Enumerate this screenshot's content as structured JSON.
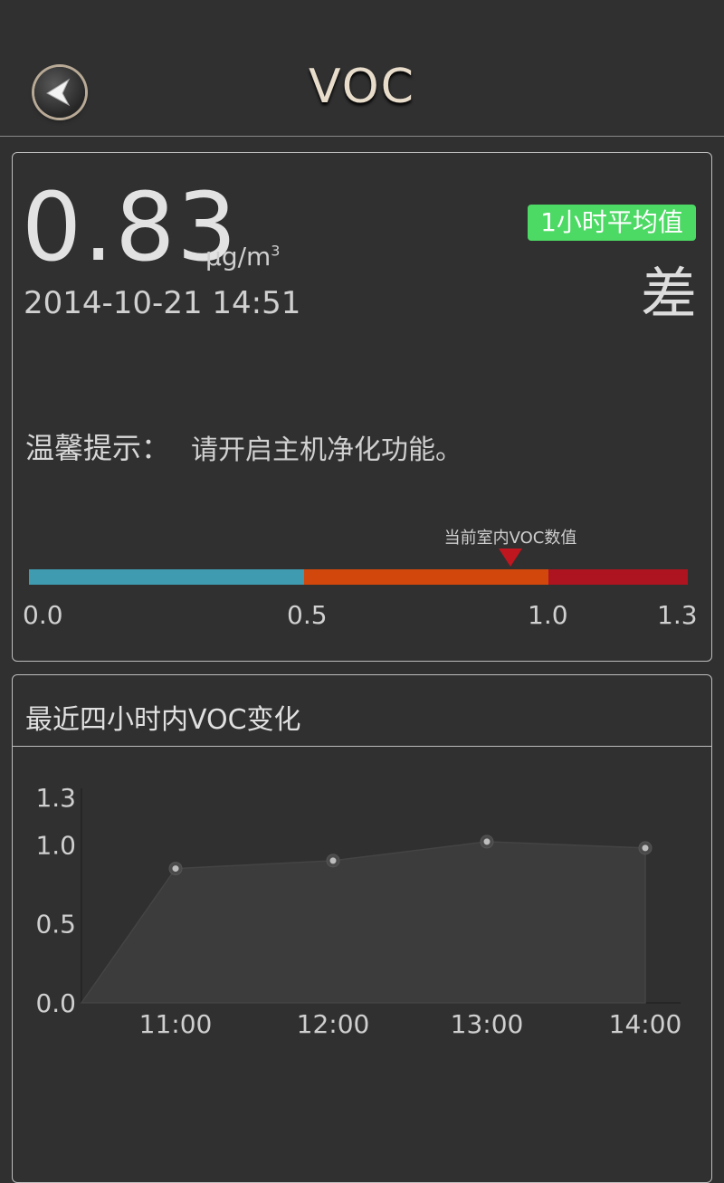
{
  "header": {
    "title": "VOC"
  },
  "reading": {
    "value": "0.83",
    "unit": "μg/m",
    "unit_sup": "3",
    "datetime": "2014-10-21 14:51",
    "badge": "1小时平均值",
    "quality": "差"
  },
  "tip": {
    "label": "温馨提示：",
    "text": "请开启主机净化功能。"
  },
  "scale": {
    "indicator_label": "当前室内VOC数值",
    "ticks": [
      "0.0",
      "0.5",
      "1.0",
      "1.3"
    ],
    "colors": {
      "good": "#3e9bb0",
      "moderate": "#d2480c",
      "poor": "#ad141f"
    }
  },
  "chart_section": {
    "title": "最近四小时内VOC变化"
  },
  "chart_data": {
    "type": "area",
    "x": [
      "11:00",
      "12:00",
      "13:00",
      "14:00"
    ],
    "series": [
      {
        "values": [
          0.85,
          0.9,
          1.02,
          0.98
        ]
      }
    ],
    "yticks": [
      "0.0",
      "0.5",
      "1.0",
      "1.3"
    ],
    "ylim": [
      0,
      1.3
    ],
    "grid": false,
    "title": "",
    "xlabel": "",
    "ylabel": ""
  }
}
